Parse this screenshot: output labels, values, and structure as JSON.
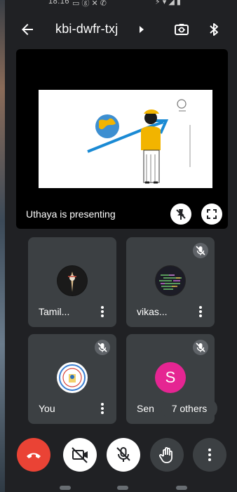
{
  "status_bar": {
    "time": "18:16",
    "left_icons": "▭ ⓖ ✕ ✆",
    "right_icons": "⚡ ▾ ◢ ▮"
  },
  "header": {
    "meeting_code": "kbi-dwfr-txj",
    "back_icon": "arrow-back-icon",
    "camera_switch_icon": "switch-camera-icon",
    "bluetooth_icon": "bluetooth-icon"
  },
  "presentation": {
    "label": "Uthaya is presenting"
  },
  "participants": [
    {
      "name": "Tamil...",
      "muted": false
    },
    {
      "name": "vikas...",
      "muted": true
    },
    {
      "name": "You",
      "muted": true
    },
    {
      "name": "Sen",
      "muted": true,
      "initial": "S",
      "avatar_color": "#e52592"
    }
  ],
  "others_chip": "7 others",
  "colors": {
    "end_call": "#ea4335",
    "tile_bg": "#3c4043",
    "app_bg": "#202124"
  }
}
